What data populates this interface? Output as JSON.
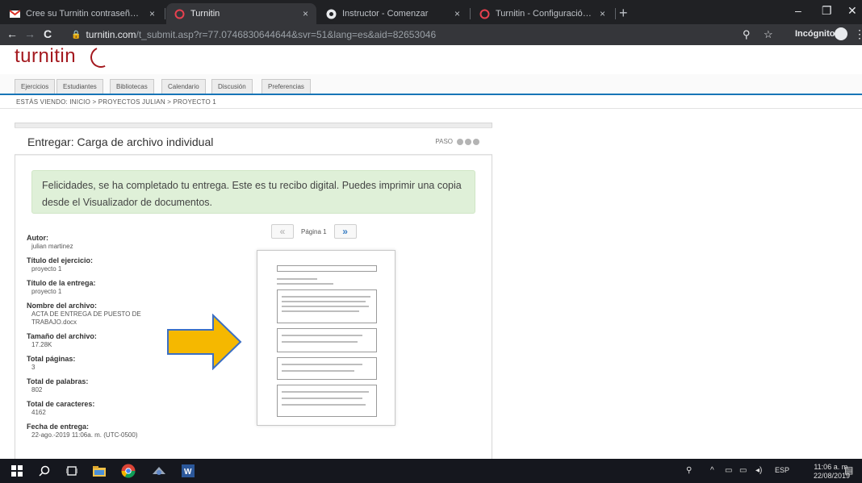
{
  "browser": {
    "tabs": [
      {
        "title": "Cree su Turnitin contraseña - idi",
        "favicon": "gmail-icon",
        "active": false
      },
      {
        "title": "Turnitin",
        "favicon": "turnitin-icon",
        "active": true
      },
      {
        "title": "Instructor - Comenzar",
        "favicon": "instructor-icon",
        "active": false
      },
      {
        "title": "Turnitin - Configuración de la cu",
        "favicon": "turnitin-icon",
        "active": false
      }
    ],
    "tab_close": "×",
    "new_tab": "+",
    "url_host": "turnitin.com",
    "url_path": "/t_submit.asp?r=77.0746830644644&svr=51&lang=es&aid=82653046",
    "incognito_label": "Incógnito",
    "window_controls": {
      "minimize": "–",
      "restore": "❐",
      "close": "✕"
    }
  },
  "app": {
    "logo_text": "turnitin",
    "nav_tabs": [
      "Ejercicios",
      "Estudiantes",
      "Bibliotecas",
      "Calendario",
      "Discusión",
      "Preferencias"
    ],
    "breadcrumb": "ESTÁS VIENDO: INICIO > PROYECTOS JULIAN > PROYECTO 1"
  },
  "panel": {
    "title": "Entregar: Carga de archivo individual",
    "step_label": "PASO",
    "alert_text": "Felicidades, se ha completado tu entrega. Este es tu recibo digital. Puedes imprimir una copia desde el Visualizador de documentos.",
    "fields": [
      {
        "label": "Autor:",
        "value": "julian martinez"
      },
      {
        "label": "Título del ejercicio:",
        "value": "proyecto 1"
      },
      {
        "label": "Título de la entrega:",
        "value": "proyecto 1"
      },
      {
        "label": "Nombre del archivo:",
        "value": "ACTA DE ENTREGA DE PUESTO DE TRABAJO.docx"
      },
      {
        "label": "Tamaño del archivo:",
        "value": "17.28K"
      },
      {
        "label": "Total páginas:",
        "value": "3"
      },
      {
        "label": "Total de palabras:",
        "value": "802"
      },
      {
        "label": "Total de caracteres:",
        "value": "4162"
      },
      {
        "label": "Fecha de entrega:",
        "value": "22-ago.-2019 11:06a. m. (UTC-0500)"
      }
    ],
    "pager": {
      "prev": "«",
      "label": "Página 1",
      "next": "»"
    }
  },
  "colors": {
    "brand": "#a4191f",
    "nav_underline": "#1775b7",
    "alert_bg": "#dff0d8",
    "arrow_fill": "#f5b800",
    "arrow_stroke": "#3b6fc4"
  },
  "taskbar": {
    "apps": [
      "windows-start-icon",
      "search-icon",
      "task-view-icon",
      "file-explorer-icon",
      "chrome-icon",
      "remote-icon",
      "word-icon"
    ],
    "tray_lang": "ESP",
    "time": "11:06 a. m.",
    "date": "22/08/2019"
  }
}
